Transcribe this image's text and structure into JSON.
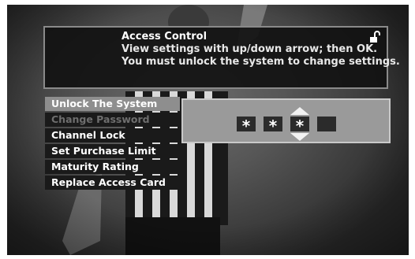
{
  "header": {
    "title": "Access Control",
    "line1": "View settings with up/down arrow; then OK.",
    "line2": "You must unlock the system to change settings.",
    "icon": "lock-icon"
  },
  "menu": {
    "items": [
      {
        "label": "Unlock The System",
        "state": "selected"
      },
      {
        "label": "Change Password",
        "state": "disabled"
      },
      {
        "label": "Channel Lock",
        "state": "normal"
      },
      {
        "label": "Set Purchase Limit",
        "state": "normal"
      },
      {
        "label": "Maturity Rating",
        "state": "normal"
      },
      {
        "label": "Replace Access Card",
        "state": "normal"
      }
    ]
  },
  "password": {
    "slots": [
      "*",
      "*",
      "*",
      ""
    ],
    "active_slot": 3
  }
}
